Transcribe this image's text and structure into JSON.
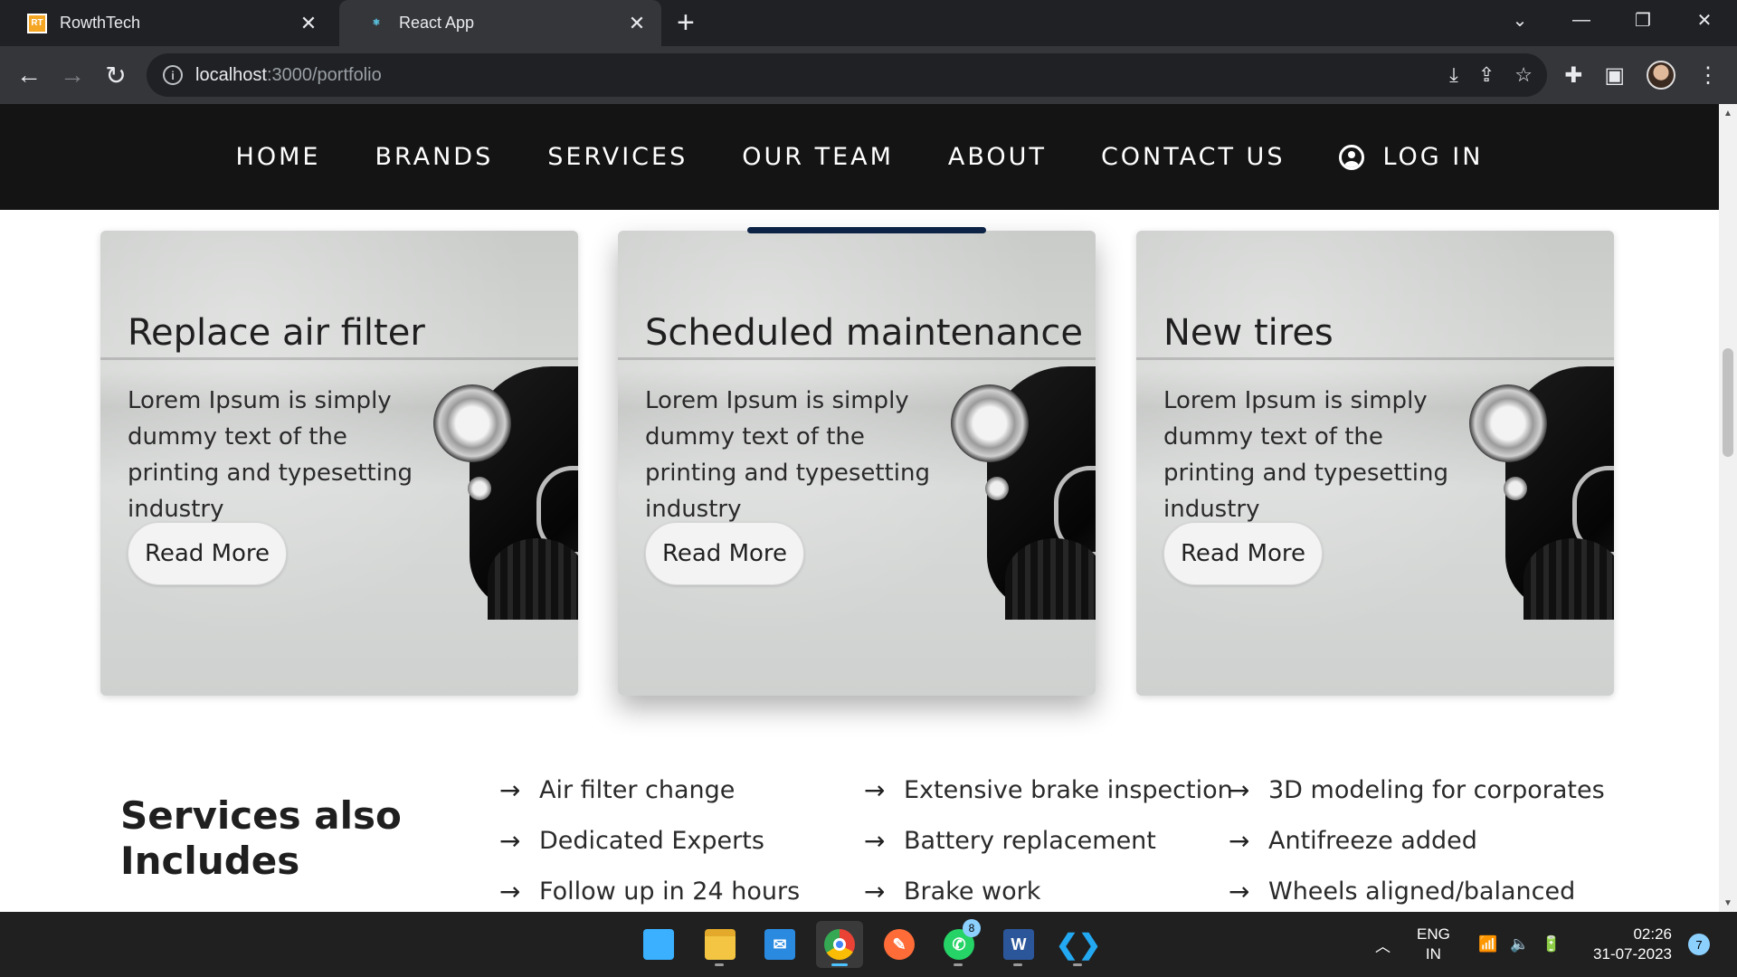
{
  "browser": {
    "tabs": [
      {
        "title": "RowthTech",
        "favicon": "RT",
        "active": false
      },
      {
        "title": "React App",
        "favicon": "react-icon",
        "active": true
      }
    ],
    "url_host": "localhost",
    "url_path": ":3000/portfolio"
  },
  "site_nav": {
    "items": [
      "HOME",
      "BRANDS",
      "SERVICES",
      "OUR TEAM",
      "ABOUT",
      "CONTACT US"
    ],
    "login_label": "LOG IN"
  },
  "cards": [
    {
      "title": "Replace air filter",
      "text": "Lorem Ipsum is simply dummy text of the printing and typesetting industry",
      "button": "Read More"
    },
    {
      "title": "Scheduled maintenance",
      "text": "Lorem Ipsum is simply dummy text of the printing and typesetting industry",
      "button": "Read More"
    },
    {
      "title": "New tires",
      "text": "Lorem Ipsum is simply dummy text of the printing and typesetting industry",
      "button": "Read More"
    }
  ],
  "services": {
    "heading": "Services also Includes",
    "columns": [
      [
        "Air filter change",
        "Dedicated Experts",
        "Follow up in 24 hours"
      ],
      [
        "Extensive brake inspection",
        "Battery replacement",
        "Brake work"
      ],
      [
        "3D modeling for corporates",
        "Antifreeze added",
        "Wheels aligned/balanced"
      ]
    ]
  },
  "taskbar": {
    "whatsapp_badge": "8",
    "lang_line1": "ENG",
    "lang_line2": "IN",
    "time": "02:26",
    "date": "31-07-2023",
    "notifications": "7"
  },
  "colors": {
    "nav_bg": "#141414",
    "active_indicator": "#0d2346",
    "chrome_dark": "#202124"
  }
}
